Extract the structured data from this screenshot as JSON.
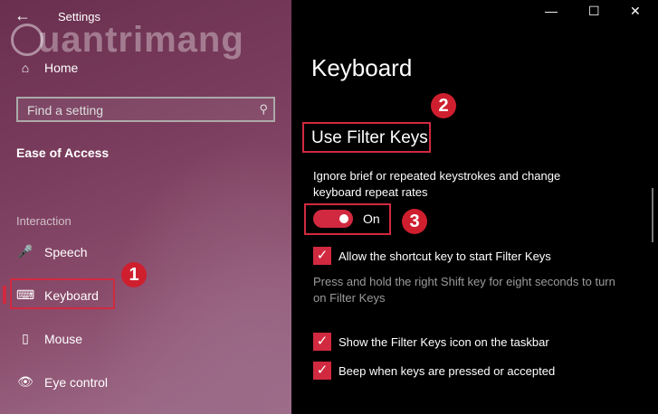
{
  "window": {
    "title": "Settings",
    "controls": [
      "minimize",
      "maximize",
      "close"
    ]
  },
  "watermark": "uantrimang",
  "sidebar": {
    "home_label": "Home",
    "search_placeholder": "Find a setting",
    "section_title": "Ease of Access",
    "group_label": "Interaction",
    "items": [
      {
        "label": "Speech",
        "icon": "microphone-icon"
      },
      {
        "label": "Keyboard",
        "icon": "keyboard-icon",
        "selected": true
      },
      {
        "label": "Mouse",
        "icon": "mouse-icon"
      },
      {
        "label": "Eye control",
        "icon": "eye-control-icon"
      }
    ]
  },
  "main": {
    "heading": "Keyboard",
    "subheading": "Use Filter Keys",
    "description": "Ignore brief or repeated keystrokes and change keyboard repeat rates",
    "toggle_state": "On",
    "option_shortcut": "Allow the shortcut key to start Filter Keys",
    "note": "Press and hold the right Shift key for eight seconds to turn on Filter Keys",
    "option_taskbar_icon": "Show the Filter Keys icon on the taskbar",
    "option_beep": "Beep when keys are pressed or accepted"
  },
  "annotations": {
    "badge1": "1",
    "badge2": "2",
    "badge3": "3"
  },
  "colors": {
    "accent": "#d1293f",
    "badge": "#cf1f2e"
  }
}
